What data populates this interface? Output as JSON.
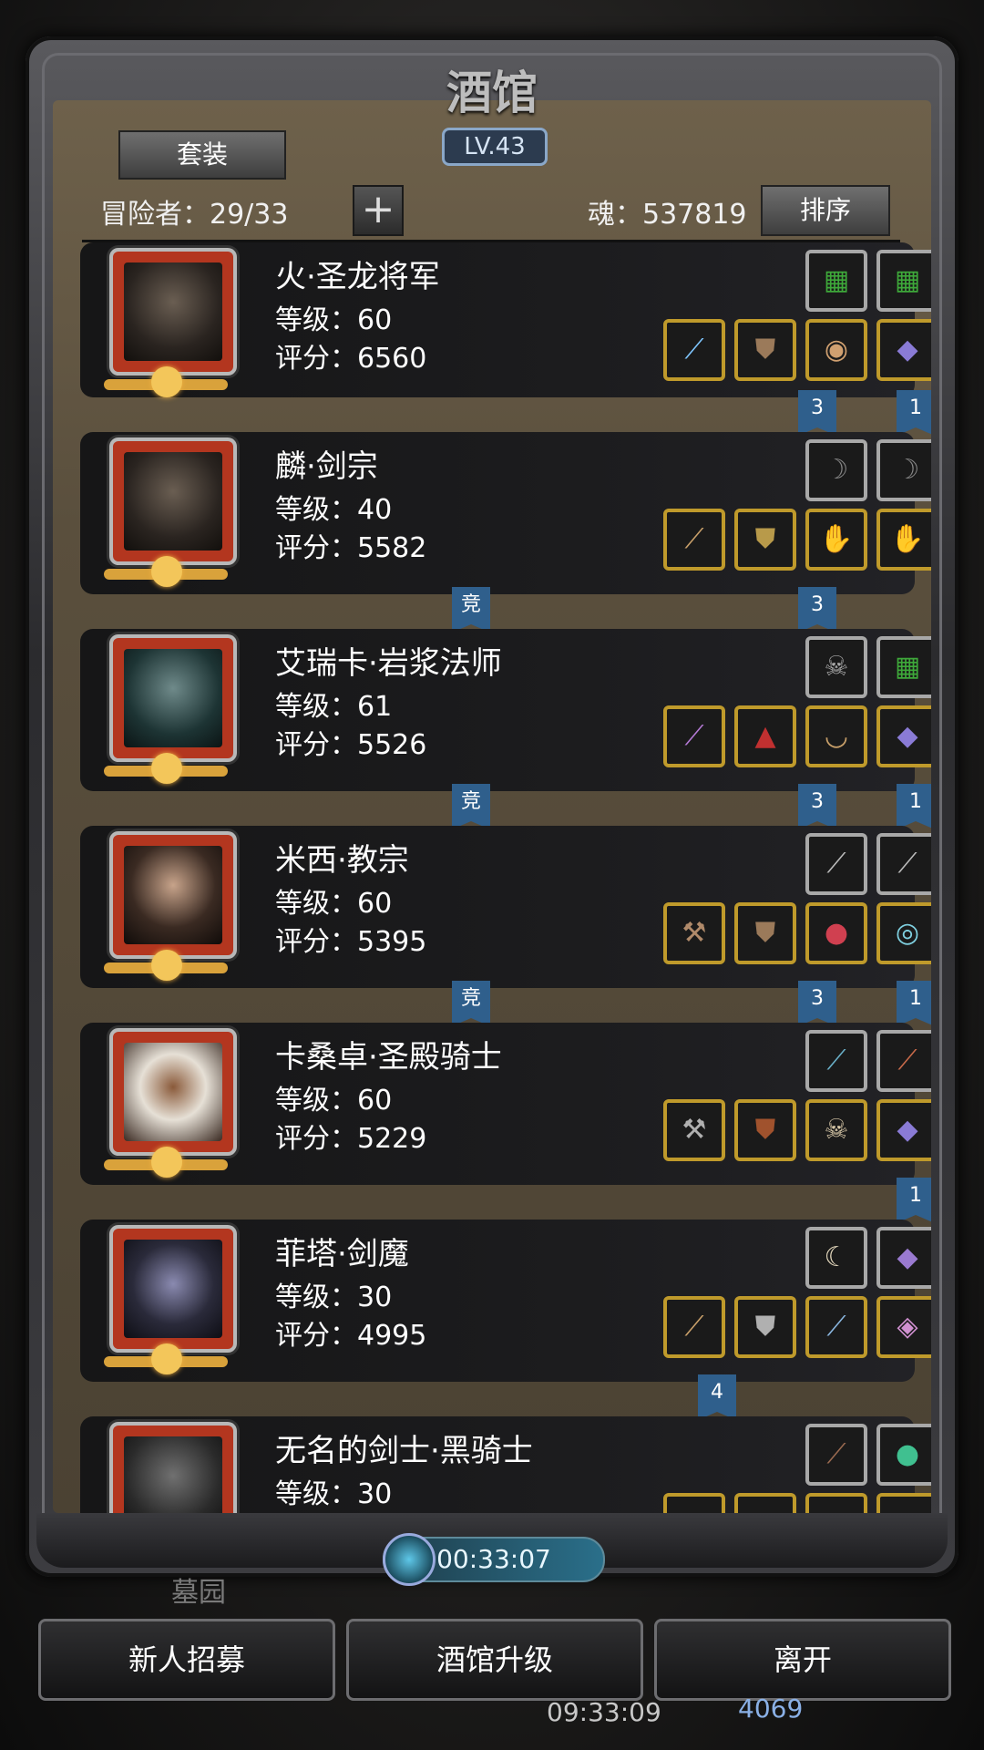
{
  "header": {
    "title": "酒馆",
    "level": "LV.43",
    "set_button": "套装",
    "adventurers": "冒险者：29/33",
    "add_button": "+",
    "soul": "魂：537819",
    "sort_button": "排序"
  },
  "heroes": [
    {
      "name": "火·圣龙将军",
      "level": "等级：60",
      "score": "评分：6560"
    },
    {
      "name": "麟·剑宗",
      "level": "等级：40",
      "score": "评分：5582"
    },
    {
      "name": "艾瑞卡·岩浆法师",
      "level": "等级：61",
      "score": "评分：5526"
    },
    {
      "name": "米西·教宗",
      "level": "等级：60",
      "score": "评分：5395"
    },
    {
      "name": "卡桑卓·圣殿骑士",
      "level": "等级：60",
      "score": "评分：5229"
    },
    {
      "name": "菲塔·剑魔",
      "level": "等级：30",
      "score": "评分：4995"
    },
    {
      "name": "无名的剑士·黑骑士",
      "level": "等级：30",
      "score": ""
    }
  ],
  "ribbons": {
    "r1a": "3",
    "r1b": "1",
    "r2a": "竞",
    "r2b": "3",
    "r3a": "竞",
    "r3b": "3",
    "r3c": "1",
    "r4a": "竞",
    "r4b": "3",
    "r4c": "1",
    "r5a": "1",
    "r6a": "4"
  },
  "footer": {
    "timer": "00:33:07",
    "bg_label": "墓园",
    "recruit_button": "新人招募",
    "upgrade_button": "酒馆升级",
    "leave_button": "离开",
    "clock": "09:33:09",
    "gems": "4069"
  }
}
